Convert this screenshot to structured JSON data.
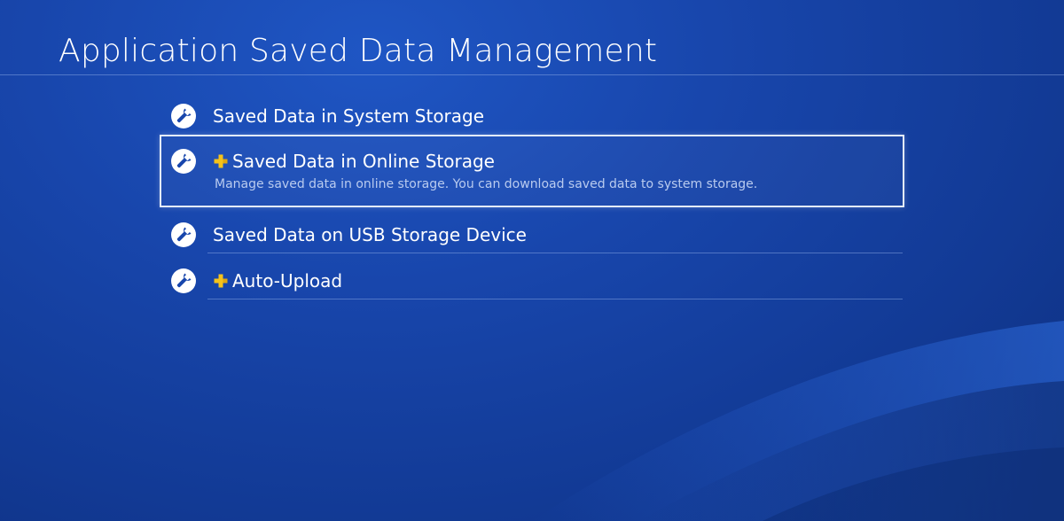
{
  "header": {
    "title": "Application Saved Data Management"
  },
  "menu": {
    "items": [
      {
        "label": "Saved Data in System Storage",
        "icon": "wrench-icon",
        "plus": false,
        "description": ""
      },
      {
        "label": "Saved Data in Online Storage",
        "icon": "wrench-icon",
        "plus": true,
        "description": "Manage saved data in online storage. You can download saved data to system storage.",
        "focused": true
      },
      {
        "label": "Saved Data on USB Storage Device",
        "icon": "wrench-icon",
        "plus": false,
        "description": ""
      },
      {
        "label": "Auto-Upload",
        "icon": "wrench-icon",
        "plus": true,
        "description": ""
      }
    ]
  },
  "colors": {
    "background": "#1846ac",
    "plus_badge": "#f5c21b",
    "focus_border": "#e3ebf8",
    "description_text": "#b9cbef"
  }
}
